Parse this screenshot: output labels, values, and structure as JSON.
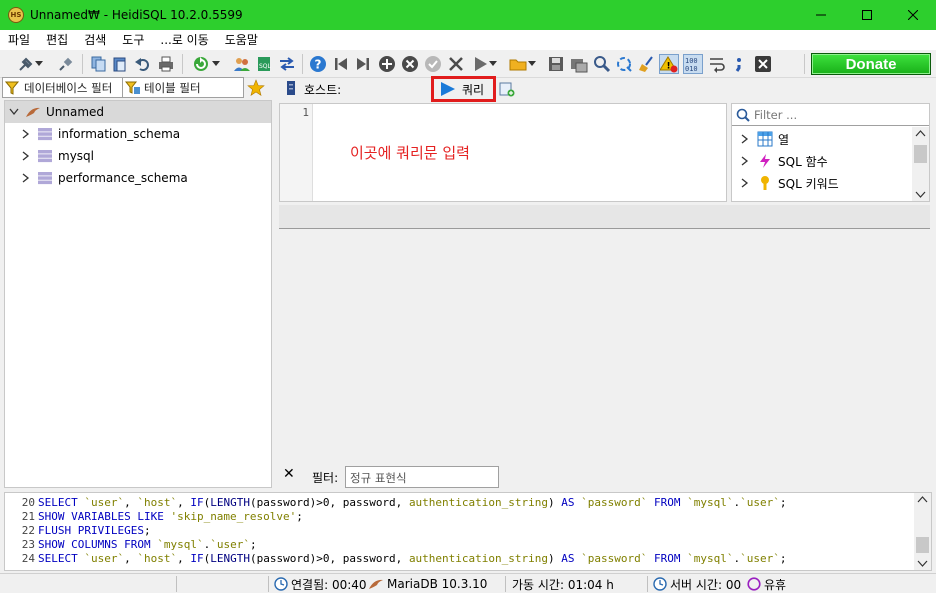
{
  "window": {
    "app_icon_text": "HS",
    "title": "Unnamed₩ - HeidiSQL 10.2.0.5599"
  },
  "menu": [
    "파일",
    "편집",
    "검색",
    "도구",
    "...로 이동",
    "도움말"
  ],
  "toolbar": {
    "donate_label": "Donate",
    "bit_icon_text": [
      "100",
      "010"
    ]
  },
  "filters": {
    "database_placeholder": "데이터베이스 필터",
    "table_placeholder": "테이블 필터"
  },
  "tree": {
    "root": "Unnamed",
    "databases": [
      "information_schema",
      "mysql",
      "performance_schema"
    ]
  },
  "editor": {
    "host_label": "호스트:",
    "query_tab_label": "쿼리",
    "line_number": "1",
    "hint_text": "이곳에 쿼리문 입력"
  },
  "helper": {
    "filter_placeholder": "Filter ...",
    "items": [
      "열",
      "SQL 함수",
      "SQL 키워드"
    ]
  },
  "result_filter": {
    "close_symbol": "✕",
    "label": "필터:",
    "placeholder": "정규 표현식"
  },
  "sql_log": [
    {
      "n": "20",
      "tokens": [
        [
          "kw",
          "SELECT "
        ],
        [
          "tk",
          "`user`"
        ],
        [
          "num",
          ", "
        ],
        [
          "tk",
          "`host`"
        ],
        [
          "num",
          ", "
        ],
        [
          "kw",
          "IF"
        ],
        [
          "num",
          "("
        ],
        [
          "fn",
          "LENGTH"
        ],
        [
          "num",
          "(password)>0, password, "
        ],
        [
          "tk",
          "authentication_string"
        ],
        [
          "num",
          ") "
        ],
        [
          "kw",
          "AS "
        ],
        [
          "tk",
          "`password`"
        ],
        [
          "num",
          " "
        ],
        [
          "kw",
          "FROM "
        ],
        [
          "tk",
          "`mysql`"
        ],
        [
          "num",
          "."
        ],
        [
          "tk",
          "`user`"
        ],
        [
          "num",
          ";"
        ]
      ]
    },
    {
      "n": "21",
      "tokens": [
        [
          "kw",
          "SHOW VARIABLES LIKE "
        ],
        [
          "str",
          "'skip_name_resolve'"
        ],
        [
          "num",
          ";"
        ]
      ]
    },
    {
      "n": "22",
      "tokens": [
        [
          "kw",
          "FLUSH PRIVILEGES"
        ],
        [
          "num",
          ";"
        ]
      ]
    },
    {
      "n": "23",
      "tokens": [
        [
          "kw",
          "SHOW COLUMNS FROM "
        ],
        [
          "tk",
          "`mysql`"
        ],
        [
          "num",
          "."
        ],
        [
          "tk",
          "`user`"
        ],
        [
          "num",
          ";"
        ]
      ]
    },
    {
      "n": "24",
      "tokens": [
        [
          "kw",
          "SELECT "
        ],
        [
          "tk",
          "`user`"
        ],
        [
          "num",
          ", "
        ],
        [
          "tk",
          "`host`"
        ],
        [
          "num",
          ", "
        ],
        [
          "kw",
          "IF"
        ],
        [
          "num",
          "("
        ],
        [
          "fn",
          "LENGTH"
        ],
        [
          "num",
          "(password)>0, password, "
        ],
        [
          "tk",
          "authentication_string"
        ],
        [
          "num",
          ") "
        ],
        [
          "kw",
          "AS "
        ],
        [
          "tk",
          "`password`"
        ],
        [
          "num",
          " "
        ],
        [
          "kw",
          "FROM "
        ],
        [
          "tk",
          "`mysql`"
        ],
        [
          "num",
          "."
        ],
        [
          "tk",
          "`user`"
        ],
        [
          "num",
          ";"
        ]
      ]
    }
  ],
  "status": {
    "connected": "연결됨: 00:40",
    "server": "MariaDB 10.3.10",
    "uptime": "가동 시간: 01:04 h",
    "server_time": "서버 시간: 00",
    "idle": "유휴"
  }
}
